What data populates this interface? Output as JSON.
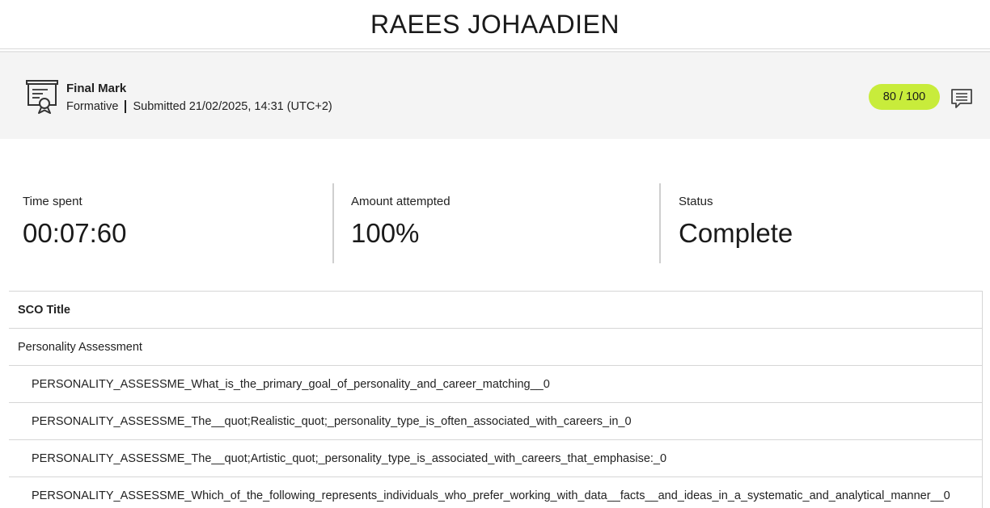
{
  "header": {
    "student_name": "RAEES JOHAADIEN"
  },
  "mark": {
    "title": "Final Mark",
    "type": "Formative",
    "submitted": "Submitted 21/02/2025, 14:31 (UTC+2)",
    "score": "80 / 100",
    "score_color": "#c8ec3b",
    "icon": "certificate-icon",
    "comment_icon": "comment-icon"
  },
  "stats": {
    "time_spent": {
      "label": "Time spent",
      "value": "00:07:60"
    },
    "amount_attempted": {
      "label": "Amount attempted",
      "value": "100%"
    },
    "status": {
      "label": "Status",
      "value": "Complete"
    }
  },
  "table": {
    "header": "SCO Title",
    "rows": [
      {
        "label": "Personality Assessment"
      },
      {
        "label": "PERSONALITY_ASSESSME_What_is_the_primary_goal_of_personality_and_career_matching__0"
      },
      {
        "label": "PERSONALITY_ASSESSME_The__quot;Realistic_quot;_personality_type_is_often_associated_with_careers_in_0"
      },
      {
        "label": "PERSONALITY_ASSESSME_The__quot;Artistic_quot;_personality_type_is_associated_with_careers_that_emphasise:_0"
      },
      {
        "label": "PERSONALITY_ASSESSME_Which_of_the_following_represents_individuals_who_prefer_working_with_data__facts__and_ideas_in_a_systematic_and_analytical_manner__0"
      }
    ]
  }
}
